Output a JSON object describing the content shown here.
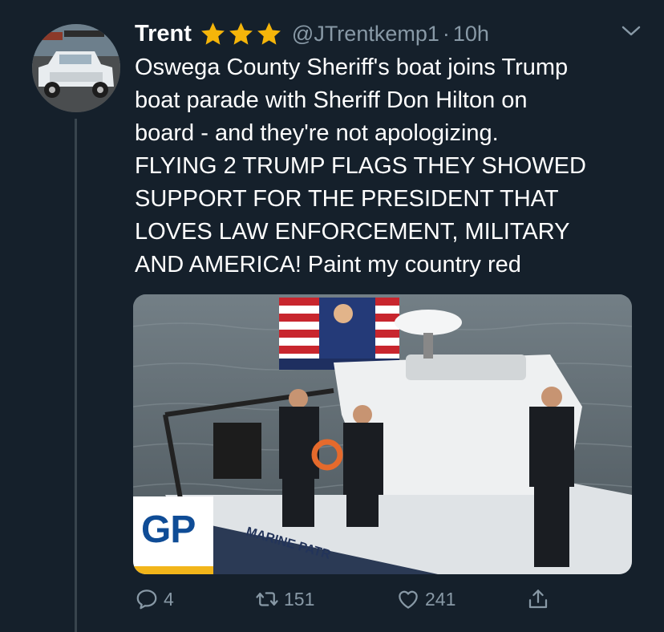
{
  "tweet": {
    "author_name": "Trent",
    "author_handle": "@JTrentkemp1",
    "separator": "·",
    "timestamp": "10h",
    "text_lines": [
      "Oswega County Sheriff's boat joins Trump",
      "boat parade with Sheriff Don Hilton on",
      "board - and they're not apologizing.",
      "FLYING 2 TRUMP FLAGS THEY SHOWED",
      "SUPPORT FOR THE PRESIDENT THAT",
      "LOVES LAW ENFORCEMENT,  MILITARY",
      "AND AMERICA! Paint my country red"
    ],
    "media": {
      "logo_text": "GP",
      "hull_text": "MARINE PATR"
    },
    "actions": {
      "reply_count": "4",
      "retweet_count": "151",
      "like_count": "241"
    }
  },
  "colors": {
    "background": "#15202b",
    "secondary_text": "#8899a6",
    "star": "#f5b50a"
  },
  "icons": {
    "name_badges": [
      "star-icon",
      "star-icon",
      "star-icon"
    ],
    "menu": "chevron-down-icon",
    "reply": "reply-icon",
    "retweet": "retweet-icon",
    "like": "heart-icon",
    "share": "share-icon"
  }
}
